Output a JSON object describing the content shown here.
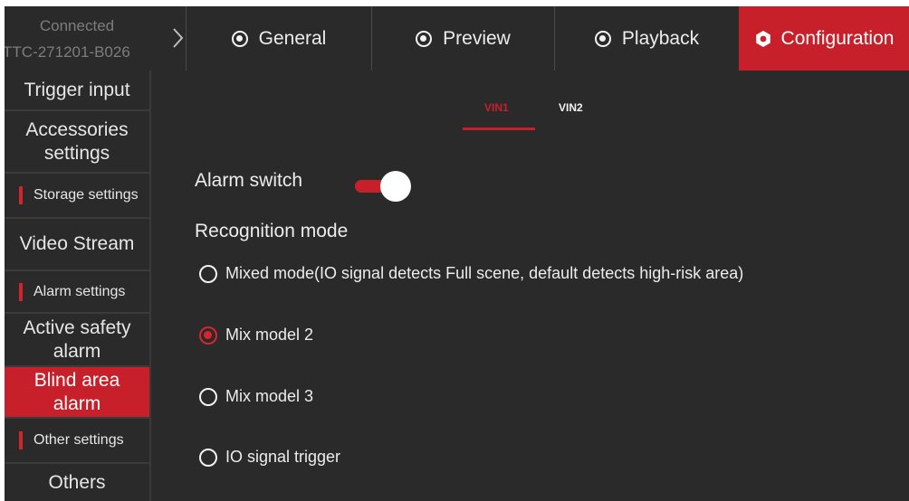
{
  "header": {
    "connection_status": "Connected",
    "device_id": "TTC-271201-B026",
    "tabs": [
      {
        "label": "General",
        "icon": "record-icon"
      },
      {
        "label": "Preview",
        "icon": "record-icon"
      },
      {
        "label": "Playback",
        "icon": "record-icon"
      },
      {
        "label": "Configuration",
        "icon": "gear-icon",
        "active": true
      }
    ]
  },
  "sidebar": {
    "items": [
      {
        "label": "Trigger input"
      },
      {
        "label": "Accessories settings"
      },
      {
        "label": "Storage settings",
        "section": true
      },
      {
        "label": "Video Stream"
      },
      {
        "label": "Alarm settings",
        "section": true
      },
      {
        "label": "Active safety alarm"
      },
      {
        "label": "Blind area alarm",
        "active": true
      },
      {
        "label": "Other settings",
        "section": true
      },
      {
        "label": "Others"
      }
    ]
  },
  "main": {
    "vin_tabs": [
      {
        "label": "VIN1",
        "active": true
      },
      {
        "label": "VIN2"
      }
    ],
    "alarm_switch": {
      "label": "Alarm switch",
      "on": true
    },
    "recognition_mode": {
      "label": "Recognition mode",
      "options": [
        {
          "label": "Mixed mode(IO signal detects Full scene, default detects high-risk area)",
          "selected": false
        },
        {
          "label": "Mix model 2",
          "selected": true
        },
        {
          "label": "Mix model 3",
          "selected": false
        },
        {
          "label": "IO signal trigger",
          "selected": false
        }
      ]
    }
  },
  "colors": {
    "accent": "#c8202a",
    "background": "#2a2a2a",
    "text": "#ececec",
    "muted": "#7d7d7d"
  }
}
